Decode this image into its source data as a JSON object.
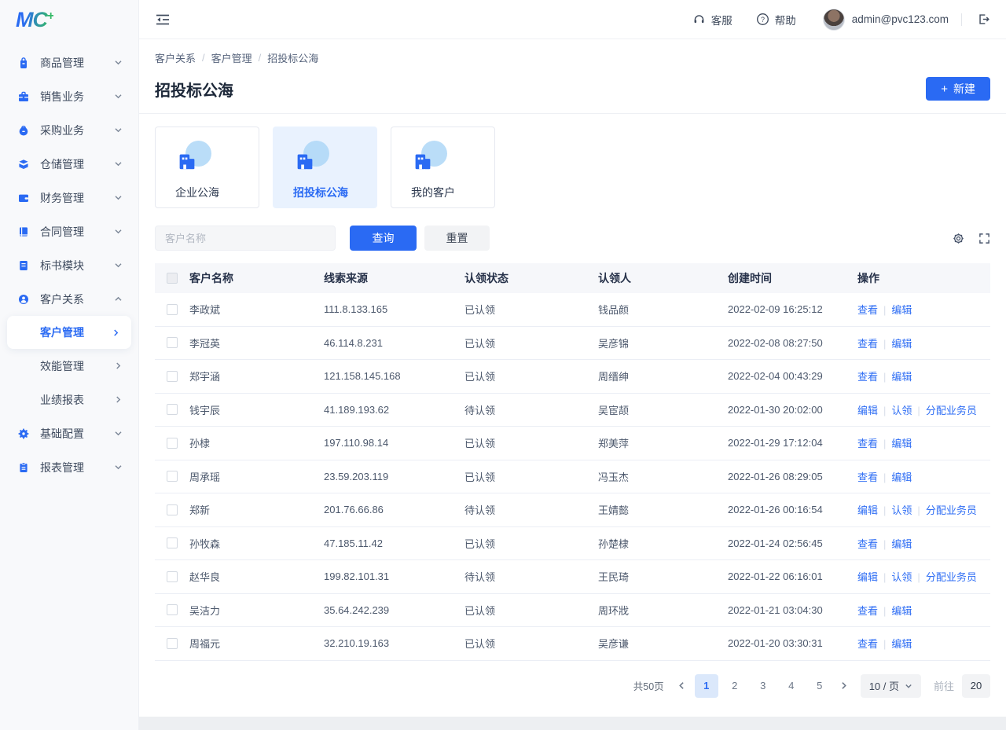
{
  "app": {
    "logo_text": "MC",
    "logo_plus": "+"
  },
  "header": {
    "service_label": "客服",
    "help_label": "帮助",
    "user_email": "admin@pvc123.com"
  },
  "breadcrumb": {
    "items": [
      "客户关系",
      "客户管理",
      "招投标公海"
    ],
    "separator": "/"
  },
  "page": {
    "title": "招投标公海",
    "create_button": "新建",
    "create_plus": "+"
  },
  "sidebar": {
    "items": [
      {
        "label": "商品管理",
        "icon": "bag-icon",
        "chevron": "down"
      },
      {
        "label": "销售业务",
        "icon": "briefcase-icon",
        "chevron": "down"
      },
      {
        "label": "采购业务",
        "icon": "purchase-icon",
        "chevron": "down"
      },
      {
        "label": "仓储管理",
        "icon": "warehouse-icon",
        "chevron": "down"
      },
      {
        "label": "财务管理",
        "icon": "wallet-icon",
        "chevron": "down"
      },
      {
        "label": "合同管理",
        "icon": "contract-icon",
        "chevron": "down"
      },
      {
        "label": "标书模块",
        "icon": "document-icon",
        "chevron": "down"
      },
      {
        "label": "客户关系",
        "icon": "customer-icon",
        "chevron": "up",
        "children": [
          {
            "label": "客户管理",
            "active": true
          },
          {
            "label": "效能管理",
            "active": false
          },
          {
            "label": "业绩报表",
            "active": false
          }
        ]
      },
      {
        "label": "基础配置",
        "icon": "config-icon",
        "chevron": "down"
      },
      {
        "label": "报表管理",
        "icon": "report-icon",
        "chevron": "down"
      }
    ]
  },
  "tabs": {
    "cards": [
      {
        "label": "企业公海",
        "active": false
      },
      {
        "label": "招投标公海",
        "active": true
      },
      {
        "label": "我的客户",
        "active": false
      }
    ]
  },
  "filter": {
    "name_placeholder": "客户名称",
    "search_button": "查询",
    "reset_button": "重置"
  },
  "table": {
    "columns": [
      "客户名称",
      "线索来源",
      "认领状态",
      "认领人",
      "创建时间",
      "操作"
    ],
    "action_separator": "|",
    "rows": [
      {
        "name": "李政斌",
        "source": "111.8.133.165",
        "status": "已认领",
        "claimer": "钱品颜",
        "created": "2022-02-09 16:25:12",
        "actions": [
          "查看",
          "编辑"
        ]
      },
      {
        "name": "李冠英",
        "source": "46.114.8.231",
        "status": "已认领",
        "claimer": "吴彦锦",
        "created": "2022-02-08 08:27:50",
        "actions": [
          "查看",
          "编辑"
        ]
      },
      {
        "name": "郑宇涵",
        "source": "121.158.145.168",
        "status": "已认领",
        "claimer": "周缙绅",
        "created": "2022-02-04 00:43:29",
        "actions": [
          "查看",
          "编辑"
        ]
      },
      {
        "name": "钱宇辰",
        "source": "41.189.193.62",
        "status": "待认领",
        "claimer": "吴宦颉",
        "created": "2022-01-30 20:02:00",
        "actions": [
          "编辑",
          "认领",
          "分配业务员"
        ]
      },
      {
        "name": "孙棣",
        "source": "197.110.98.14",
        "status": "已认领",
        "claimer": "郑美萍",
        "created": "2022-01-29 17:12:04",
        "actions": [
          "查看",
          "编辑"
        ]
      },
      {
        "name": "周承瑶",
        "source": "23.59.203.119",
        "status": "已认领",
        "claimer": "冯玉杰",
        "created": "2022-01-26 08:29:05",
        "actions": [
          "查看",
          "编辑"
        ]
      },
      {
        "name": "郑新",
        "source": "201.76.66.86",
        "status": "待认领",
        "claimer": "王婧懿",
        "created": "2022-01-26 00:16:54",
        "actions": [
          "编辑",
          "认领",
          "分配业务员"
        ]
      },
      {
        "name": "孙牧森",
        "source": "47.185.11.42",
        "status": "已认领",
        "claimer": "孙楚棣",
        "created": "2022-01-24 02:56:45",
        "actions": [
          "查看",
          "编辑"
        ]
      },
      {
        "name": "赵华良",
        "source": "199.82.101.31",
        "status": "待认领",
        "claimer": "王民琦",
        "created": "2022-01-22 06:16:01",
        "actions": [
          "编辑",
          "认领",
          "分配业务员"
        ]
      },
      {
        "name": "吴洁力",
        "source": "35.64.242.239",
        "status": "已认领",
        "claimer": "周环戕",
        "created": "2022-01-21 03:04:30",
        "actions": [
          "查看",
          "编辑"
        ]
      },
      {
        "name": "周福元",
        "source": "32.210.19.163",
        "status": "已认领",
        "claimer": "吴彦谦",
        "created": "2022-01-20 03:30:31",
        "actions": [
          "查看",
          "编辑"
        ]
      }
    ]
  },
  "pagination": {
    "total": "共50页",
    "pages": [
      "1",
      "2",
      "3",
      "4",
      "5"
    ],
    "active_page": "1",
    "page_size": "10 / 页",
    "goto_label": "前往",
    "goto_value": "20"
  },
  "colors": {
    "accent": "#2a6af3",
    "accent_light": "#e9f2fe",
    "table_header_bg": "#f6f7fa"
  }
}
